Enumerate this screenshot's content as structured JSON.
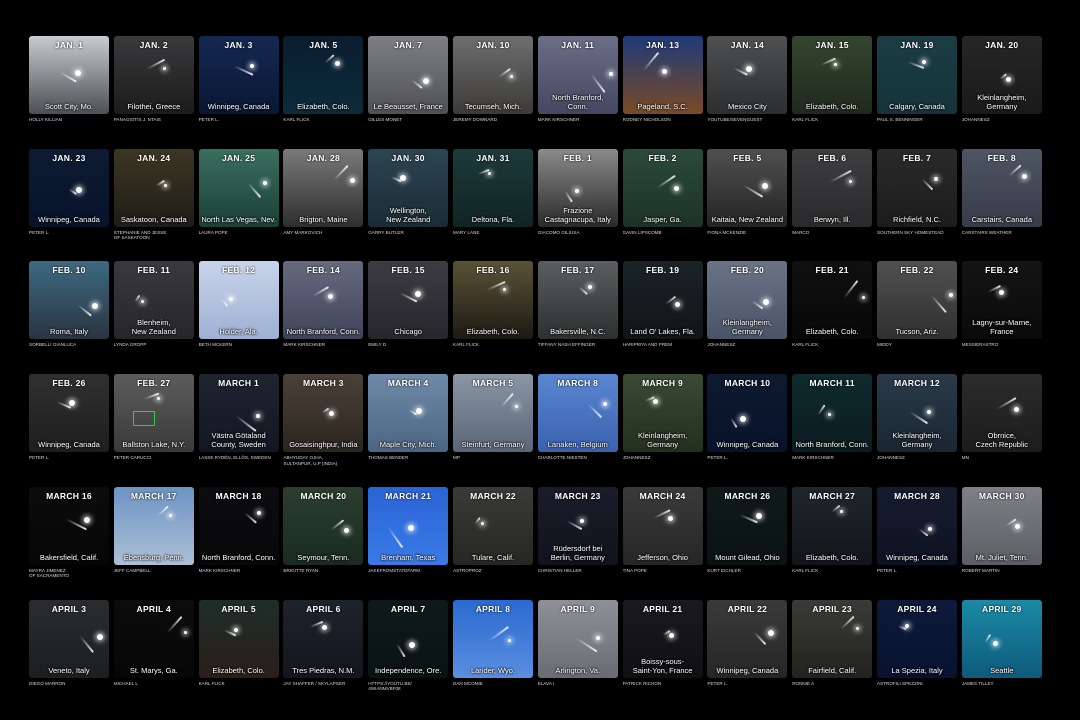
{
  "panels": [
    {
      "date": "JAN. 1",
      "location": "Scott City, Mo.",
      "credit": "HOLLY KILLIAN",
      "bg": [
        "#c9cccf",
        "#4c4f53"
      ]
    },
    {
      "date": "JAN. 2",
      "location": "Filothei, Greece",
      "credit": "PANAGIOTIS J. NTAIS",
      "bg": [
        "#3a3a3c",
        "#1b1b1c"
      ]
    },
    {
      "date": "JAN. 3",
      "location": "Winnipeg, Canada",
      "credit": "PETER L.",
      "bg": [
        "#142852",
        "#091733"
      ]
    },
    {
      "date": "JAN. 5",
      "location": "Elizabeth, Colo.",
      "credit": "KARL FLICK",
      "bg": [
        "#0b1d2f",
        "#0b2b3b"
      ]
    },
    {
      "date": "JAN. 7",
      "location": "Le Beausset, France",
      "credit": "GILLES MONET",
      "bg": [
        "#7e7f82",
        "#505154"
      ]
    },
    {
      "date": "JAN. 10",
      "location": "Tecumseh, Mich.",
      "credit": "JEREMY DOWNARD",
      "bg": [
        "#6e6e6f",
        "#3b3a38"
      ]
    },
    {
      "date": "JAN. 11",
      "location": "North Branford,\nConn.",
      "credit": "MARK KIRSCHNER",
      "bg": [
        "#6b6e86",
        "#444760"
      ]
    },
    {
      "date": "JAN. 13",
      "location": "Pageland, S.C.",
      "credit": "RODNEY NICHOLSON",
      "bg": [
        "#1e3a7a",
        "#7a4a24"
      ]
    },
    {
      "date": "JAN. 14",
      "location": "Mexico City",
      "credit": "YOUTUBE/SEVENGUEST",
      "bg": [
        "#4e5052",
        "#2c2e30"
      ]
    },
    {
      "date": "JAN. 15",
      "location": "Elizabeth, Colo.",
      "credit": "KARL FLICK",
      "bg": [
        "#35452e",
        "#1f2a1d"
      ]
    },
    {
      "date": "JAN. 19",
      "location": "Calgary, Canada",
      "credit": "PAUL S. BENNINGER",
      "bg": [
        "#1c3d44",
        "#14343a"
      ]
    },
    {
      "date": "JAN. 20",
      "location": "Kleinlangheim,\nGermany",
      "credit": "JOHANNESZ",
      "bg": [
        "#262626",
        "#1a1a1a"
      ]
    },
    {
      "date": "JAN. 23",
      "location": "Winnipeg, Canada",
      "credit": "PETER L.",
      "bg": [
        "#0c1b33",
        "#08132a"
      ]
    },
    {
      "date": "JAN. 24",
      "location": "Saskatoon, Canada",
      "credit": "STEPHANIE AND JESSE\nOF SASKATOON",
      "bg": [
        "#3d3624",
        "#1e1c16"
      ]
    },
    {
      "date": "JAN. 25",
      "location": "North Las Vegas, Nev.",
      "credit": "LAURA POPE",
      "bg": [
        "#3a6f5f",
        "#1b4036"
      ]
    },
    {
      "date": "JAN. 28",
      "location": "Brigton, Maine",
      "credit": "AMY MARKOVICH",
      "bg": [
        "#7a7a7a",
        "#2e2e2e"
      ]
    },
    {
      "date": "JAN. 30",
      "location": "Wellington,\nNew Zealand",
      "credit": "GARRY BUTLER",
      "bg": [
        "#2d4552",
        "#1a2c36"
      ]
    },
    {
      "date": "JAN. 31",
      "location": "Deltona, Fla.",
      "credit": "MARY LANE",
      "bg": [
        "#1d3a3a",
        "#112424"
      ]
    },
    {
      "date": "FEB. 1",
      "location": "Frazione\nCastagnacupa, Italy",
      "credit": "GIACOMO GILIUSA",
      "bg": [
        "#8a8a8a",
        "#2a2a2a"
      ]
    },
    {
      "date": "FEB. 2",
      "location": "Jasper, Ga.",
      "credit": "GAVIN LIPSCOMB",
      "bg": [
        "#2c4a3c",
        "#1c3228"
      ]
    },
    {
      "date": "FEB. 5",
      "location": "Kaitaia, New Zealand",
      "credit": "FIONA MCKENZIE",
      "bg": [
        "#505050",
        "#242424"
      ]
    },
    {
      "date": "FEB. 6",
      "location": "Berwyn, Ill.",
      "credit": "MARCO",
      "bg": [
        "#3e3e40",
        "#2a2a2c"
      ]
    },
    {
      "date": "FEB. 7",
      "location": "Richfield, N.C.",
      "credit": "SOUTHERN SKY HOMESTEAD",
      "bg": [
        "#2a2a2a",
        "#1c1c1c"
      ]
    },
    {
      "date": "FEB. 8",
      "location": "Carstairs, Canada",
      "credit": "CARSTAIRS WEATHER",
      "bg": [
        "#4e5563",
        "#363c48"
      ]
    },
    {
      "date": "FEB. 10",
      "location": "Roma, Italy",
      "credit": "SORBELLI GIANLUCA",
      "bg": [
        "#3d6a82",
        "#2a3440"
      ]
    },
    {
      "date": "FEB. 11",
      "location": "Blenheim,\nNew Zealand",
      "credit": "LYNDA GROPP",
      "bg": [
        "#3a3a3e",
        "#26262a"
      ]
    },
    {
      "date": "FEB. 12",
      "location": "Holder, Ala.",
      "credit": "BETH MCKERN",
      "bg": [
        "#c8d4ea",
        "#9eb0d4"
      ]
    },
    {
      "date": "FEB. 14",
      "location": "North Branford, Conn.",
      "credit": "MARK KIRSCHNER",
      "bg": [
        "#666a7e",
        "#40445a"
      ]
    },
    {
      "date": "FEB. 15",
      "location": "Chicago",
      "credit": "EMILY D",
      "bg": [
        "#3c3c42",
        "#26262c"
      ]
    },
    {
      "date": "FEB. 16",
      "location": "Elizabeth, Colo.",
      "credit": "KARL FLICK",
      "bg": [
        "#5a5236",
        "#1c1a14"
      ]
    },
    {
      "date": "FEB. 17",
      "location": "Bakersville, N.C.",
      "credit": "TIFFANY NASH EFFINGER",
      "bg": [
        "#5a5e60",
        "#2c3030"
      ]
    },
    {
      "date": "FEB. 19",
      "location": "Land O' Lakes, Fla.",
      "credit": "HARIPRIYA AND PREM",
      "bg": [
        "#1a2326",
        "#101618"
      ]
    },
    {
      "date": "FEB. 20",
      "location": "Kleinlangheim,\nGermany",
      "credit": "JOHANNESZ",
      "bg": [
        "#6a7486",
        "#4a5466"
      ]
    },
    {
      "date": "FEB. 21",
      "location": "Elizabeth, Colo.",
      "credit": "KARL FLICK",
      "bg": [
        "#101010",
        "#080808"
      ]
    },
    {
      "date": "FEB. 22",
      "location": "Tucson, Ariz.",
      "credit": "MIDDY",
      "bg": [
        "#505050",
        "#303030"
      ]
    },
    {
      "date": "FEB. 24",
      "location": "Lagny-sur-Marne,\nFrance",
      "credit": "MESSIERASTRO",
      "bg": [
        "#141414",
        "#0a0a0a"
      ]
    },
    {
      "date": "FEB. 26",
      "location": "Winnipeg, Canada",
      "credit": "PETER L.",
      "bg": [
        "#303030",
        "#1e1e1e"
      ]
    },
    {
      "date": "FEB. 27",
      "location": "Ballston Lake, N.Y.",
      "credit": "PETER CARUCCI",
      "bg": [
        "#5c5c5c",
        "#3a3a3a"
      ]
    },
    {
      "date": "MARCH 1",
      "location": "Västra Götaland\nCounty, Sweden",
      "credit": "LASSE RYDÉN, ELLÖS, SWEDEN",
      "bg": [
        "#1e2430",
        "#121722"
      ]
    },
    {
      "date": "MARCH 3",
      "location": "Gosaisinghpur, India",
      "credit": "ABHYUDAY OJHA,\nSULTANPUR, U.P (INDIA)",
      "bg": [
        "#4a4038",
        "#2c2620"
      ]
    },
    {
      "date": "MARCH 4",
      "location": "Maple City, Mich.",
      "credit": "THOMAS BENDER",
      "bg": [
        "#6f8aa8",
        "#4b6683"
      ]
    },
    {
      "date": "MARCH 5",
      "location": "Steinfurt, Germany",
      "credit": "MP",
      "bg": [
        "#8a96a6",
        "#5a6676"
      ]
    },
    {
      "date": "MARCH 8",
      "location": "Lanaken, Belgium",
      "credit": "CHARLOTTE NIESTEN",
      "bg": [
        "#5a86d0",
        "#3a62ae"
      ]
    },
    {
      "date": "MARCH 9",
      "location": "Kleinlangheim,\nGermany",
      "credit": "JOHANNESZ",
      "bg": [
        "#3a4a34",
        "#22301e"
      ]
    },
    {
      "date": "MARCH 10",
      "location": "Winnipeg, Canada",
      "credit": "PETER L.",
      "bg": [
        "#0e1a30",
        "#08122a"
      ]
    },
    {
      "date": "MARCH 11",
      "location": "North Branford, Conn.",
      "credit": "MARK KIRSCHNER",
      "bg": [
        "#0f2a2e",
        "#0a1c20"
      ]
    },
    {
      "date": "MARCH 12",
      "location": "Kleinlangheim,\nGermany",
      "credit": "JOHANNESZ",
      "bg": [
        "#2a3a4a",
        "#1a2632"
      ]
    },
    {
      "date": "",
      "location": "Obrnice,\nCzech Republic",
      "credit": "MN",
      "bg": [
        "#2c2c2c",
        "#1c1c1c"
      ]
    },
    {
      "date": "MARCH 16",
      "location": "Bakersfield, Calif.",
      "credit": "MAYRA JIMENEZ\nOF SACRAMENTO",
      "bg": [
        "#0c0c0c",
        "#060606"
      ]
    },
    {
      "date": "MARCH 17",
      "location": "Ebensburg, Penn.",
      "credit": "JEFF CAMPBELL",
      "bg": [
        "#6c94c4",
        "#aebfd6"
      ]
    },
    {
      "date": "MARCH 18",
      "location": "North Branford, Conn.",
      "credit": "MARK KIRSCHNER",
      "bg": [
        "#0c0c10",
        "#08080a"
      ]
    },
    {
      "date": "MARCH 20",
      "location": "Seymour, Tenn.",
      "credit": "BRIGITTE RYAN",
      "bg": [
        "#2c3e30",
        "#1a2a20"
      ]
    },
    {
      "date": "MARCH 21",
      "location": "Brenham, Texas",
      "credit": "JAKEFROMSTATEFARM",
      "bg": [
        "#2a64d6",
        "#3a7ae6"
      ]
    },
    {
      "date": "MARCH 22",
      "location": "Tulare, Calif.",
      "credit": "ASTROPROZ",
      "bg": [
        "#3a3a38",
        "#262624"
      ]
    },
    {
      "date": "MARCH 23",
      "location": "Rüdersdorf bei\nBerlin, Germany",
      "credit": "CHRISTIAN HELLER",
      "bg": [
        "#1a1c2a",
        "#10121c"
      ]
    },
    {
      "date": "MARCH 24",
      "location": "Jefferson, Ohio",
      "credit": "TINA POPE",
      "bg": [
        "#3a3a3a",
        "#262626"
      ]
    },
    {
      "date": "MARCH 26",
      "location": "Mount Gilead, Ohio",
      "credit": "KURT EICHLER",
      "bg": [
        "#101a1a",
        "#0a1212"
      ]
    },
    {
      "date": "MARCH 27",
      "location": "Elizabeth, Colo.",
      "credit": "KARL FLICK",
      "bg": [
        "#20262c",
        "#12161a"
      ]
    },
    {
      "date": "MARCH 28",
      "location": "Winnipeg, Canada",
      "credit": "PETER L.",
      "bg": [
        "#161c30",
        "#0e1222"
      ]
    },
    {
      "date": "MARCH 30",
      "location": "Mt. Juliet, Tenn.",
      "credit": "ROBERT MARTIN",
      "bg": [
        "#7e8086",
        "#5c5e64"
      ]
    },
    {
      "date": "APRIL 3",
      "location": "Veneto, Italy",
      "credit": "DIEGO MARRON",
      "bg": [
        "#2a2c30",
        "#1c1e22"
      ]
    },
    {
      "date": "APRIL 4",
      "location": "St. Marys, Ga.",
      "credit": "MICHAEL L",
      "bg": [
        "#0c0c0c",
        "#060606"
      ]
    },
    {
      "date": "APRIL 5",
      "location": "Elizabeth, Colo.",
      "credit": "KARL FLICK",
      "bg": [
        "#1e2e2a",
        "#2a1e1a"
      ]
    },
    {
      "date": "APRIL 6",
      "location": "Tres Piedras, N.M.",
      "credit": "JAY SHAFFER / SKYLAPSER",
      "bg": [
        "#1e222c",
        "#14161c"
      ]
    },
    {
      "date": "APRIL 7",
      "location": "Independence, Ore.",
      "credit": "HTTPS://YOUTU.BE/\n4WIANMVBF08",
      "bg": [
        "#0e1a1a",
        "#0a1212"
      ]
    },
    {
      "date": "APRIL 8",
      "location": "Lander, Wyo.",
      "credit": "DAN MCOMIE",
      "bg": [
        "#2a6ad0",
        "#5a8ee0"
      ]
    },
    {
      "date": "APRIL 9",
      "location": "Arlington, Va.",
      "credit": "ELAVA I.",
      "bg": [
        "#8e9098",
        "#6a6c74"
      ]
    },
    {
      "date": "APRIL 21",
      "location": "Boissy-sous-\nSaint-Yon, France",
      "credit": "PATRICK RICHON",
      "bg": [
        "#1a1a1e",
        "#101014"
      ]
    },
    {
      "date": "APRIL 22",
      "location": "Winnipeg, Canada",
      "credit": "PETER L.",
      "bg": [
        "#3a3a3a",
        "#262626"
      ]
    },
    {
      "date": "APRIL 23",
      "location": "Fairfield, Calif.",
      "credit": "RONNIE A",
      "bg": [
        "#3a3a36",
        "#22221e"
      ]
    },
    {
      "date": "APRIL 24",
      "location": "La Spezia, Italy",
      "credit": "ASTROFILI SPEZZINI",
      "bg": [
        "#0e1a3a",
        "#081230"
      ]
    },
    {
      "date": "APRIL 29",
      "location": "Seattle",
      "credit": "JAMES TILLEY",
      "bg": [
        "#1a8aa6",
        "#0e5a7a"
      ]
    }
  ]
}
